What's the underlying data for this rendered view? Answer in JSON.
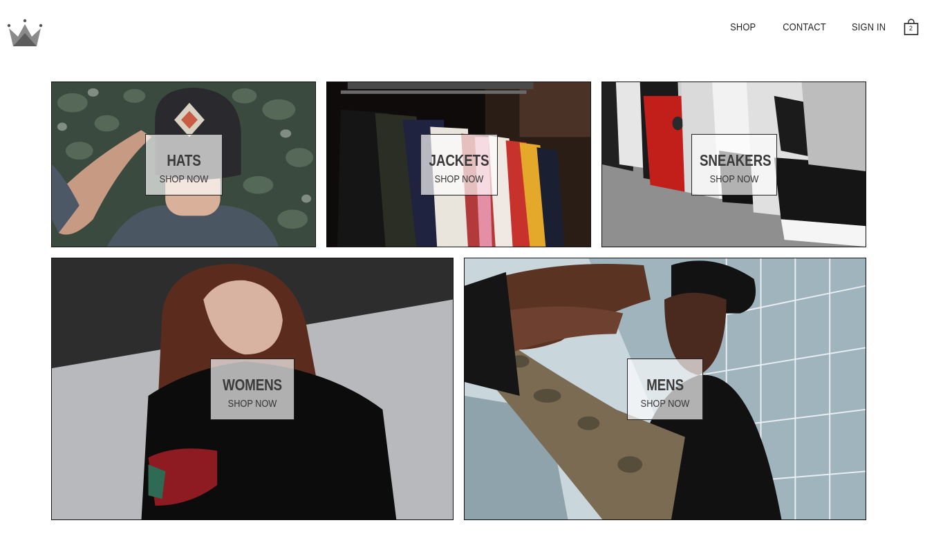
{
  "header": {
    "logo_icon": "crown-icon",
    "nav": [
      {
        "label": "SHOP"
      },
      {
        "label": "CONTACT"
      },
      {
        "label": "SIGN IN"
      }
    ],
    "cart": {
      "icon": "shopping-bag-icon",
      "count": "2"
    }
  },
  "categories": [
    {
      "title": "HATS",
      "cta": "SHOP NOW"
    },
    {
      "title": "JACKETS",
      "cta": "SHOP NOW"
    },
    {
      "title": "SNEAKERS",
      "cta": "SHOP NOW"
    },
    {
      "title": "WOMENS",
      "cta": "SHOP NOW"
    },
    {
      "title": "MENS",
      "cta": "SHOP NOW"
    }
  ]
}
